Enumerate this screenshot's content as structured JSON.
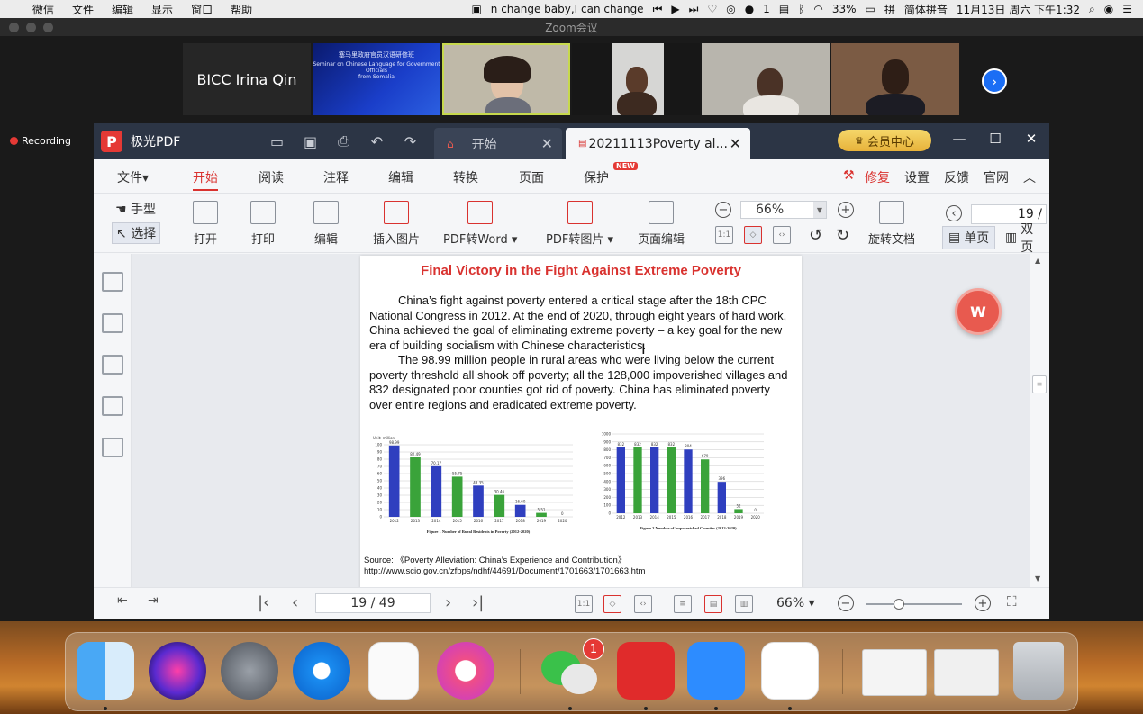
{
  "menubar": {
    "app_items": [
      "微信",
      "文件",
      "编辑",
      "显示",
      "窗口",
      "帮助"
    ],
    "now_playing": "n change baby,I can change",
    "wechat_count": "1",
    "battery": "33%",
    "input_method": "简体拼音",
    "datetime": "11月13日 周六 下午1:32"
  },
  "zoom": {
    "window_title": "Zoom会议",
    "participant_name": "BICC Irina Qin",
    "slide_line1": "塞马里政府官员汉语研修班",
    "slide_line2": "Seminar on Chinese Language for Government Officials",
    "slide_line3": "from Somalia",
    "recording_label": "Recording"
  },
  "pdf_app": {
    "name": "极光PDF",
    "tabs": [
      {
        "label": "开始"
      },
      {
        "label": "20211113Poverty al..."
      }
    ],
    "vip_label": "会员中心",
    "menu": [
      "文件▾",
      "开始",
      "阅读",
      "注释",
      "编辑",
      "转换",
      "页面",
      "保护"
    ],
    "new_badge": "NEW",
    "menu_right": [
      "修复",
      "设置",
      "反馈",
      "官网"
    ],
    "tools": {
      "hand": "手型",
      "select": "选择",
      "open": "打开",
      "print": "打印",
      "edit": "编辑",
      "insert_image": "插入图片",
      "pdf_to_word": "PDF转Word",
      "pdf_to_image": "PDF转图片",
      "page_edit": "页面编辑",
      "rotate_doc": "旋转文档",
      "single_page": "单页",
      "double_page": "双页"
    },
    "zoom_value": "66%",
    "page_number_top": "19 /",
    "status": {
      "page_indicator": "19 / 49",
      "zoom_value": "66%"
    }
  },
  "document": {
    "title": "Final Victory in the Fight Against Extreme Poverty",
    "paragraph1": "China’s fight against poverty entered a critical stage after the 18th CPC National Congress in 2012. At the end of 2020, through eight years of hard work, China achieved the goal of eliminating extreme poverty – a key goal for the new era of building socialism with Chinese characteristics.",
    "paragraph2": "The 98.99 million people in rural areas who were living below the current poverty threshold all shook off poverty; all the 128,000 impoverished villages and 832 designated poor counties got rid of poverty. China has eliminated poverty over entire regions and eradicated extreme poverty.",
    "source_line1": "Source: 《Poverty Alleviation: China’s Experience and Contribution》",
    "source_line2": "http://www.scio.gov.cn/zfbps/ndhf/44691/Document/1701663/1701663.htm"
  },
  "chart_data": [
    {
      "type": "bar",
      "title": "Figure 1    Number of Rural Residents in Poverty (2012-2020)",
      "unit_label": "Unit: million",
      "categories": [
        "2012",
        "2013",
        "2014",
        "2015",
        "2016",
        "2017",
        "2018",
        "2019",
        "2020"
      ],
      "values": [
        98.99,
        82.49,
        70.17,
        55.75,
        43.35,
        30.46,
        16.6,
        5.51,
        0
      ],
      "value_labels": [
        "98.99",
        "82.49",
        "70.17",
        "55.75",
        "43.35",
        "30.46",
        "16.60",
        "5.51",
        "0"
      ],
      "ylim": [
        0,
        100
      ],
      "yticks": [
        0,
        10,
        20,
        30,
        40,
        50,
        60,
        70,
        80,
        90,
        100
      ],
      "colors": [
        "#2f3fbf",
        "#3aa33a"
      ]
    },
    {
      "type": "bar",
      "title": "Figure 2    Number of Impoverished Counties (2012-2020)",
      "categories": [
        "2012",
        "2013",
        "2014",
        "2015",
        "2016",
        "2017",
        "2018",
        "2019",
        "2020"
      ],
      "values": [
        832,
        832,
        832,
        832,
        804,
        679,
        396,
        52,
        0
      ],
      "value_labels": [
        "832",
        "832",
        "832",
        "832",
        "804",
        "679",
        "396",
        "52",
        "0"
      ],
      "ylim": [
        0,
        1000
      ],
      "yticks": [
        0,
        100,
        200,
        300,
        400,
        500,
        600,
        700,
        800,
        900,
        1000
      ],
      "colors": [
        "#2f3fbf",
        "#3aa33a"
      ]
    }
  ]
}
